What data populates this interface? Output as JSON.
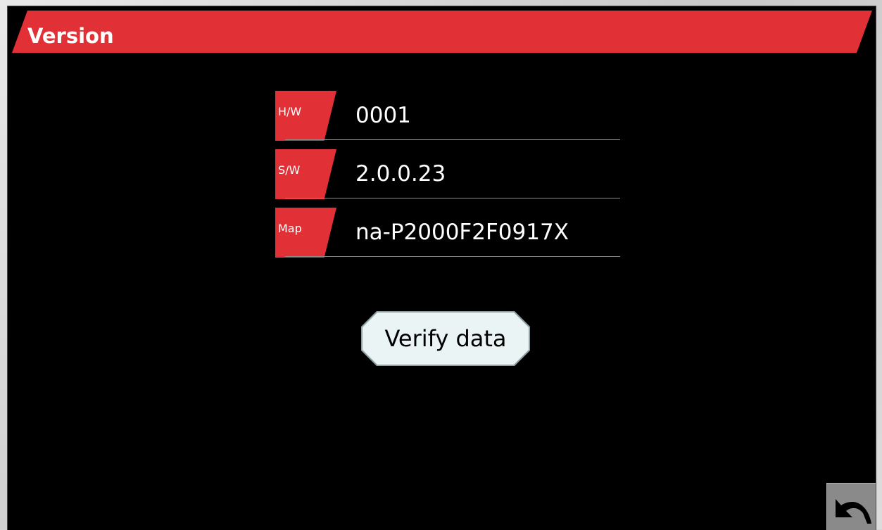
{
  "header": {
    "title": "Version"
  },
  "rows": [
    {
      "tag": "H/W",
      "value": "0001"
    },
    {
      "tag": "S/W",
      "value": "2.0.0.23"
    },
    {
      "tag": "Map",
      "value": "na-P2000F2F0917X"
    }
  ],
  "actions": {
    "verify_label": "Verify data"
  },
  "icons": {
    "back": "return-arrow-icon"
  },
  "colors": {
    "accent": "#e23037",
    "background": "#000000",
    "button_fill": "#eaf4f5",
    "back_button": "#8a8a8a"
  }
}
